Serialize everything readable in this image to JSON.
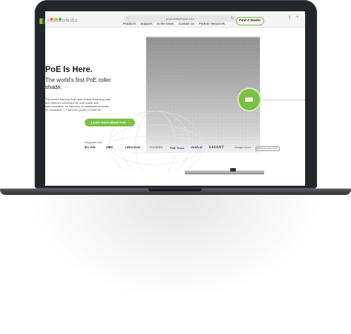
{
  "browser": {
    "url": "poweredbytrupoe.com",
    "dots": [
      "#ff5f57",
      "#febc2e",
      "#28c840"
    ]
  },
  "nav": {
    "logo_text": "POWERSHADES",
    "items": [
      "Products",
      "Support",
      "In the news",
      "Contact us",
      "Partner resources"
    ],
    "cta": "Find A Dealer"
  },
  "hero": {
    "title": "PoE Is Here.",
    "subtitle": "The world's first PoE roller shade.",
    "body": "The world's first true PoE roller shade. Requiring only one ethernet connection for both power and communication. No injectors, no additional hardware, no converters — That's the power of TruePoE.",
    "button": "Learn more about PoE"
  },
  "integrations": {
    "label": "Integrates with",
    "brands": [
      "ELAN",
      "URC",
      "CRESTRON",
      "Control4",
      "PoE Texas",
      "Josh.ai",
      "SAVANT",
      "Google Home",
      "Works with Apple Home"
    ]
  },
  "colors": {
    "accent": "#7ac143",
    "laptop": "#23272c"
  }
}
